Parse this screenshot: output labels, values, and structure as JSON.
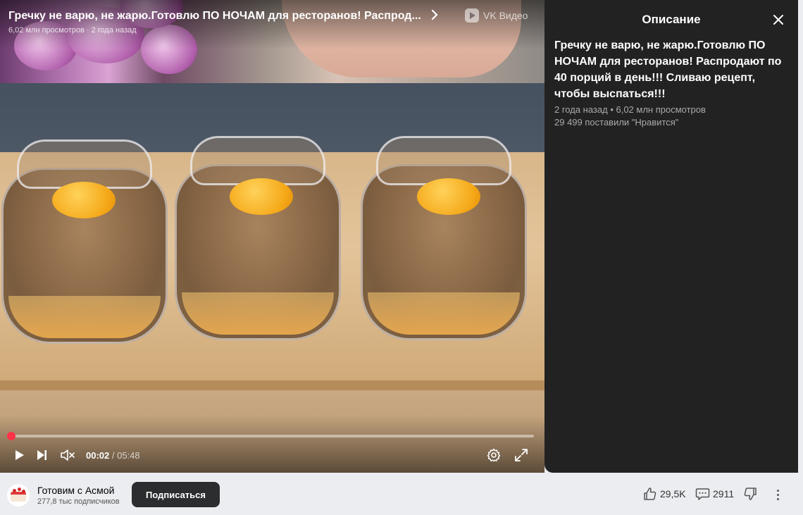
{
  "player": {
    "title": "Гречку не варю, не жарю.Готовлю ПО НОЧАМ для ресторанов! Распрод...",
    "views_short": "6,02 млн просмотров",
    "age": "2 года назад",
    "meta_separator": " · ",
    "brand": "VK Видео",
    "time_current": "00:02",
    "time_separator": " / ",
    "time_total": "05:48",
    "progress_fraction": 0.006,
    "muted": true,
    "accent_color": "#ff3347"
  },
  "description": {
    "header": "Описание",
    "title": "Гречку не варю, не жарю.Готовлю ПО НОЧАМ для ресторанов! Распродают по 40 порций в день!!! Сливаю рецепт, чтобы выспаться!!!",
    "meta_line": "2 года назад • 6,02 млн просмотров",
    "likes_line": "29 499 поставили \"Нравится\""
  },
  "channel": {
    "name": "Готовим с Асмой",
    "subscribers": "277,8 тыс подписчиков",
    "subscribe_label": "Подписаться"
  },
  "actions": {
    "likes": "29,5K",
    "comments": "2911"
  },
  "icons": {
    "play": "play-icon",
    "next": "next-icon",
    "mute": "muted-speaker-icon",
    "settings": "gear-icon",
    "fullscreen": "fullscreen-icon",
    "close": "close-icon",
    "like": "thumbs-up-icon",
    "comment": "comment-icon",
    "dislike": "thumbs-down-icon",
    "more": "more-vertical-icon",
    "chevron": "chevron-right-icon",
    "brand": "vk-video-logo-icon"
  }
}
